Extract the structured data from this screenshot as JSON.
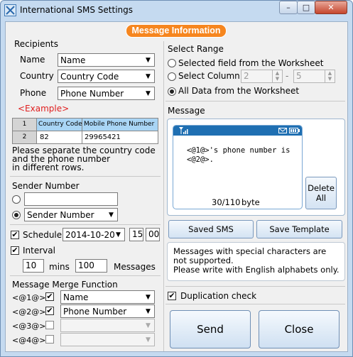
{
  "window": {
    "title": "International SMS Settings",
    "min": "–",
    "max": "□",
    "close": "✕"
  },
  "header": {
    "pill": "Message Information"
  },
  "recipients": {
    "title": "Recipients",
    "name_label": "Name",
    "name_value": "Name",
    "country_label": "Country",
    "country_value": "Country Code",
    "phone_label": "Phone",
    "phone_value": "Phone Number",
    "example_label": "<Example>",
    "table": {
      "headers": [
        "Country Code",
        "Mobile Phone Number"
      ],
      "rows": [
        [
          "1",
          "82",
          "29965421"
        ],
        [
          "2",
          "",
          ""
        ]
      ]
    },
    "note_lines": [
      "Please separate the country code",
      "and the phone number",
      "in different rows."
    ]
  },
  "sender": {
    "title": "Sender Number",
    "text_value": "",
    "combo_value": "Sender Number"
  },
  "schedule": {
    "label": "Schedule",
    "date": "2014-10-20",
    "hour": "15",
    "minute": "00",
    "checked": "✔"
  },
  "interval": {
    "label": "Interval",
    "mins_value": "10",
    "mins_label": "mins",
    "msgs_value": "100",
    "msgs_label": "Messages",
    "checked": "✔"
  },
  "merge": {
    "title": "Message Merge Function",
    "rows": [
      {
        "tag": "<@1@>",
        "checked": "✔",
        "value": "Name"
      },
      {
        "tag": "<@2@>",
        "checked": "✔",
        "value": "Phone Number"
      },
      {
        "tag": "<@3@>",
        "checked": "",
        "value": ""
      },
      {
        "tag": "<@4@>",
        "checked": "",
        "value": ""
      }
    ]
  },
  "range": {
    "title": "Select Range",
    "opt_selected_field": "Selected field from the Worksheet",
    "opt_select_column": "Select Column",
    "col_from": "2",
    "col_dash": "-",
    "col_to": "5",
    "opt_all_data": "All Data from the Worksheet"
  },
  "message": {
    "title": "Message",
    "line1": "<@1@>'s phone number is",
    "line2": "<@2@>.",
    "count": "30/110",
    "unit": "byte",
    "delete_label": "Delete All"
  },
  "buttons": {
    "saved_sms": "Saved SMS",
    "save_template": "Save Template",
    "send": "Send",
    "close": "Close"
  },
  "notice": {
    "line1": "Messages with special characters are",
    "line2": "not supported.",
    "line3": "Please write with English alphabets only."
  },
  "duplication": {
    "label": "Duplication check",
    "checked": "✔"
  }
}
